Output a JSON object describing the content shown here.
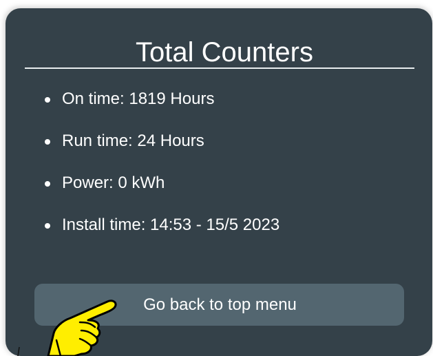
{
  "card": {
    "title": "Total Counters",
    "counters": [
      {
        "text": "On time: 1819 Hours"
      },
      {
        "text": "Run time: 24 Hours"
      },
      {
        "text": "Power: 0 kWh"
      },
      {
        "text": "Install time: 14:53 - 15/5 2023"
      }
    ],
    "back_button_label": "Go back to top menu"
  },
  "colors": {
    "panel_bg": "#344149",
    "button_bg": "#536670",
    "text": "#ffffff",
    "pointer_fill": "#ffee00",
    "pointer_stroke": "#000000"
  },
  "icons": {
    "pointer": "pointing-hand-icon"
  }
}
